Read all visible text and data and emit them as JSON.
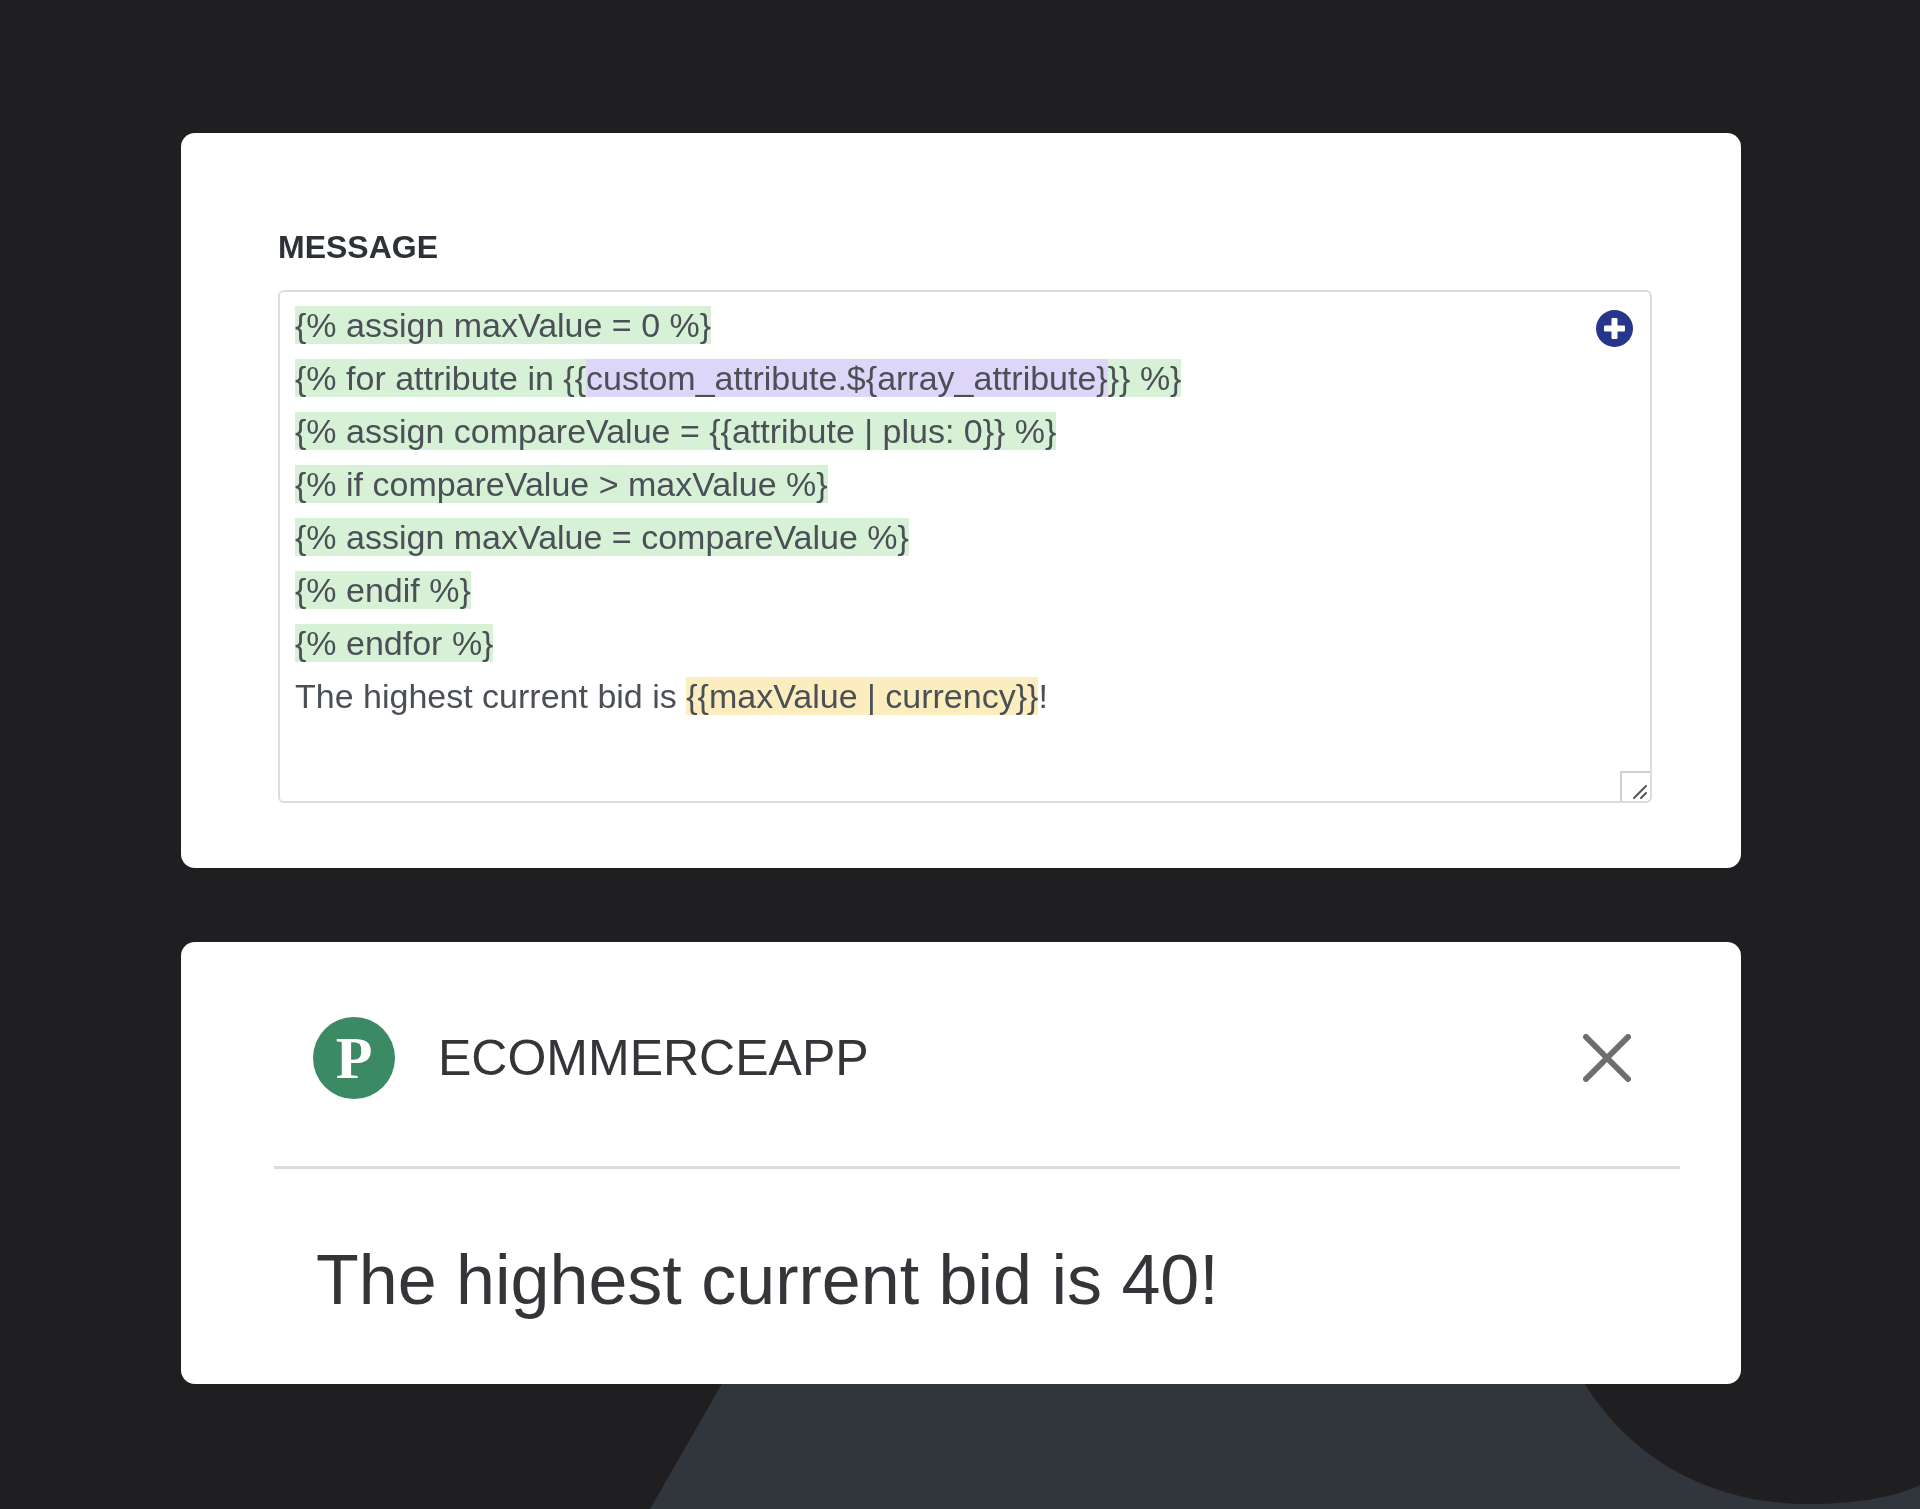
{
  "message_card": {
    "label": "MESSAGE",
    "lines": [
      {
        "segments": [
          {
            "kind": "liquid",
            "text": "{% assign maxValue = 0 %}"
          }
        ]
      },
      {
        "segments": [
          {
            "kind": "liquid",
            "text": "{% for attribute in {{"
          },
          {
            "kind": "attribute",
            "text": "custom_attribute.${array_attribute}"
          },
          {
            "kind": "liquid",
            "text": "}} %}"
          }
        ]
      },
      {
        "segments": [
          {
            "kind": "liquid",
            "text": "{% assign compareValue = {{attribute | plus: 0}} %}"
          }
        ]
      },
      {
        "segments": [
          {
            "kind": "liquid",
            "text": "{% if compareValue > maxValue %}"
          }
        ]
      },
      {
        "segments": [
          {
            "kind": "liquid",
            "text": "{% assign maxValue = compareValue %}"
          }
        ]
      },
      {
        "segments": [
          {
            "kind": "liquid",
            "text": "{% endif %}"
          }
        ]
      },
      {
        "segments": [
          {
            "kind": "liquid",
            "text": "{% endfor %}"
          }
        ]
      },
      {
        "segments": [
          {
            "kind": "plain",
            "text": "The highest current bid is "
          },
          {
            "kind": "variable",
            "text": "{{maxValue | currency}}"
          },
          {
            "kind": "plain",
            "text": "!"
          }
        ]
      }
    ]
  },
  "notification_card": {
    "logo_letter": "P",
    "app_name": "ECOMMERCEAPP",
    "message": "The highest current bid is 40!"
  }
}
